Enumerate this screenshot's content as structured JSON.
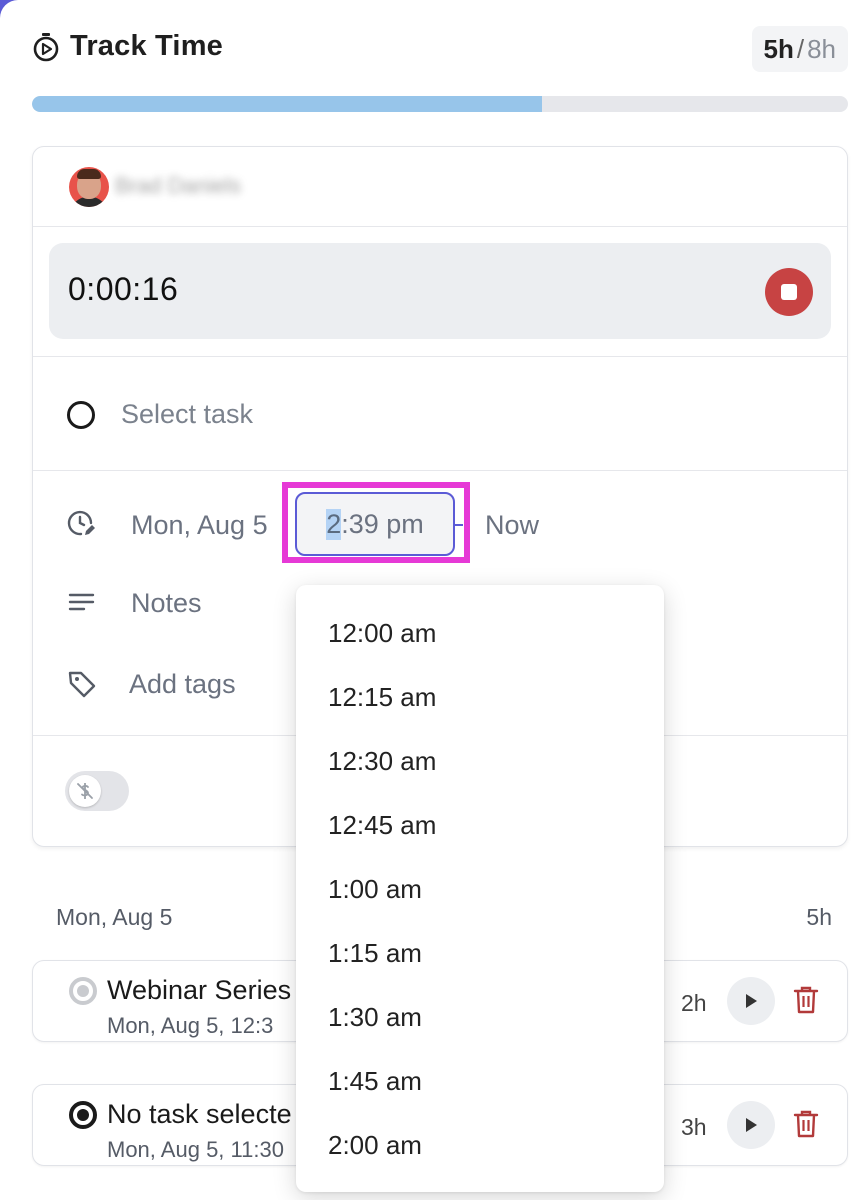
{
  "header": {
    "title": "Track Time",
    "hours_logged": "5h",
    "hours_separator": "/",
    "hours_target": "8h",
    "progress_fraction": 0.625,
    "progress_color": "#97c5ea"
  },
  "timer": {
    "user_name": "Brad Daniels",
    "elapsed": "0:00:16",
    "stop_color": "#c74343"
  },
  "form": {
    "task_placeholder": "Select task",
    "date": "Mon, Aug 5",
    "start_time_first": "2",
    "start_time_rest": ":39 pm",
    "end_time": "Now",
    "notes_placeholder": "Notes",
    "tags_placeholder": "Add tags",
    "billable_icon": "no-dollar-icon"
  },
  "time_dropdown": {
    "options": [
      "12:00 am",
      "12:15 am",
      "12:30 am",
      "12:45 am",
      "1:00 am",
      "1:15 am",
      "1:30 am",
      "1:45 am",
      "2:00 am"
    ]
  },
  "day_group": {
    "label": "Mon, Aug 5",
    "total": "5h"
  },
  "entries": [
    {
      "title": "Webinar Series",
      "subtitle": "Mon, Aug 5, 12:3",
      "duration": "2h",
      "status": "in-progress"
    },
    {
      "title": "No task selecte",
      "subtitle": "Mon, Aug 5, 11:30",
      "duration": "3h",
      "status": "complete"
    }
  ],
  "colors": {
    "accent": "#5b5bd6",
    "highlight": "#e639d6",
    "danger": "#c74343",
    "trash": "#b23a3a"
  }
}
